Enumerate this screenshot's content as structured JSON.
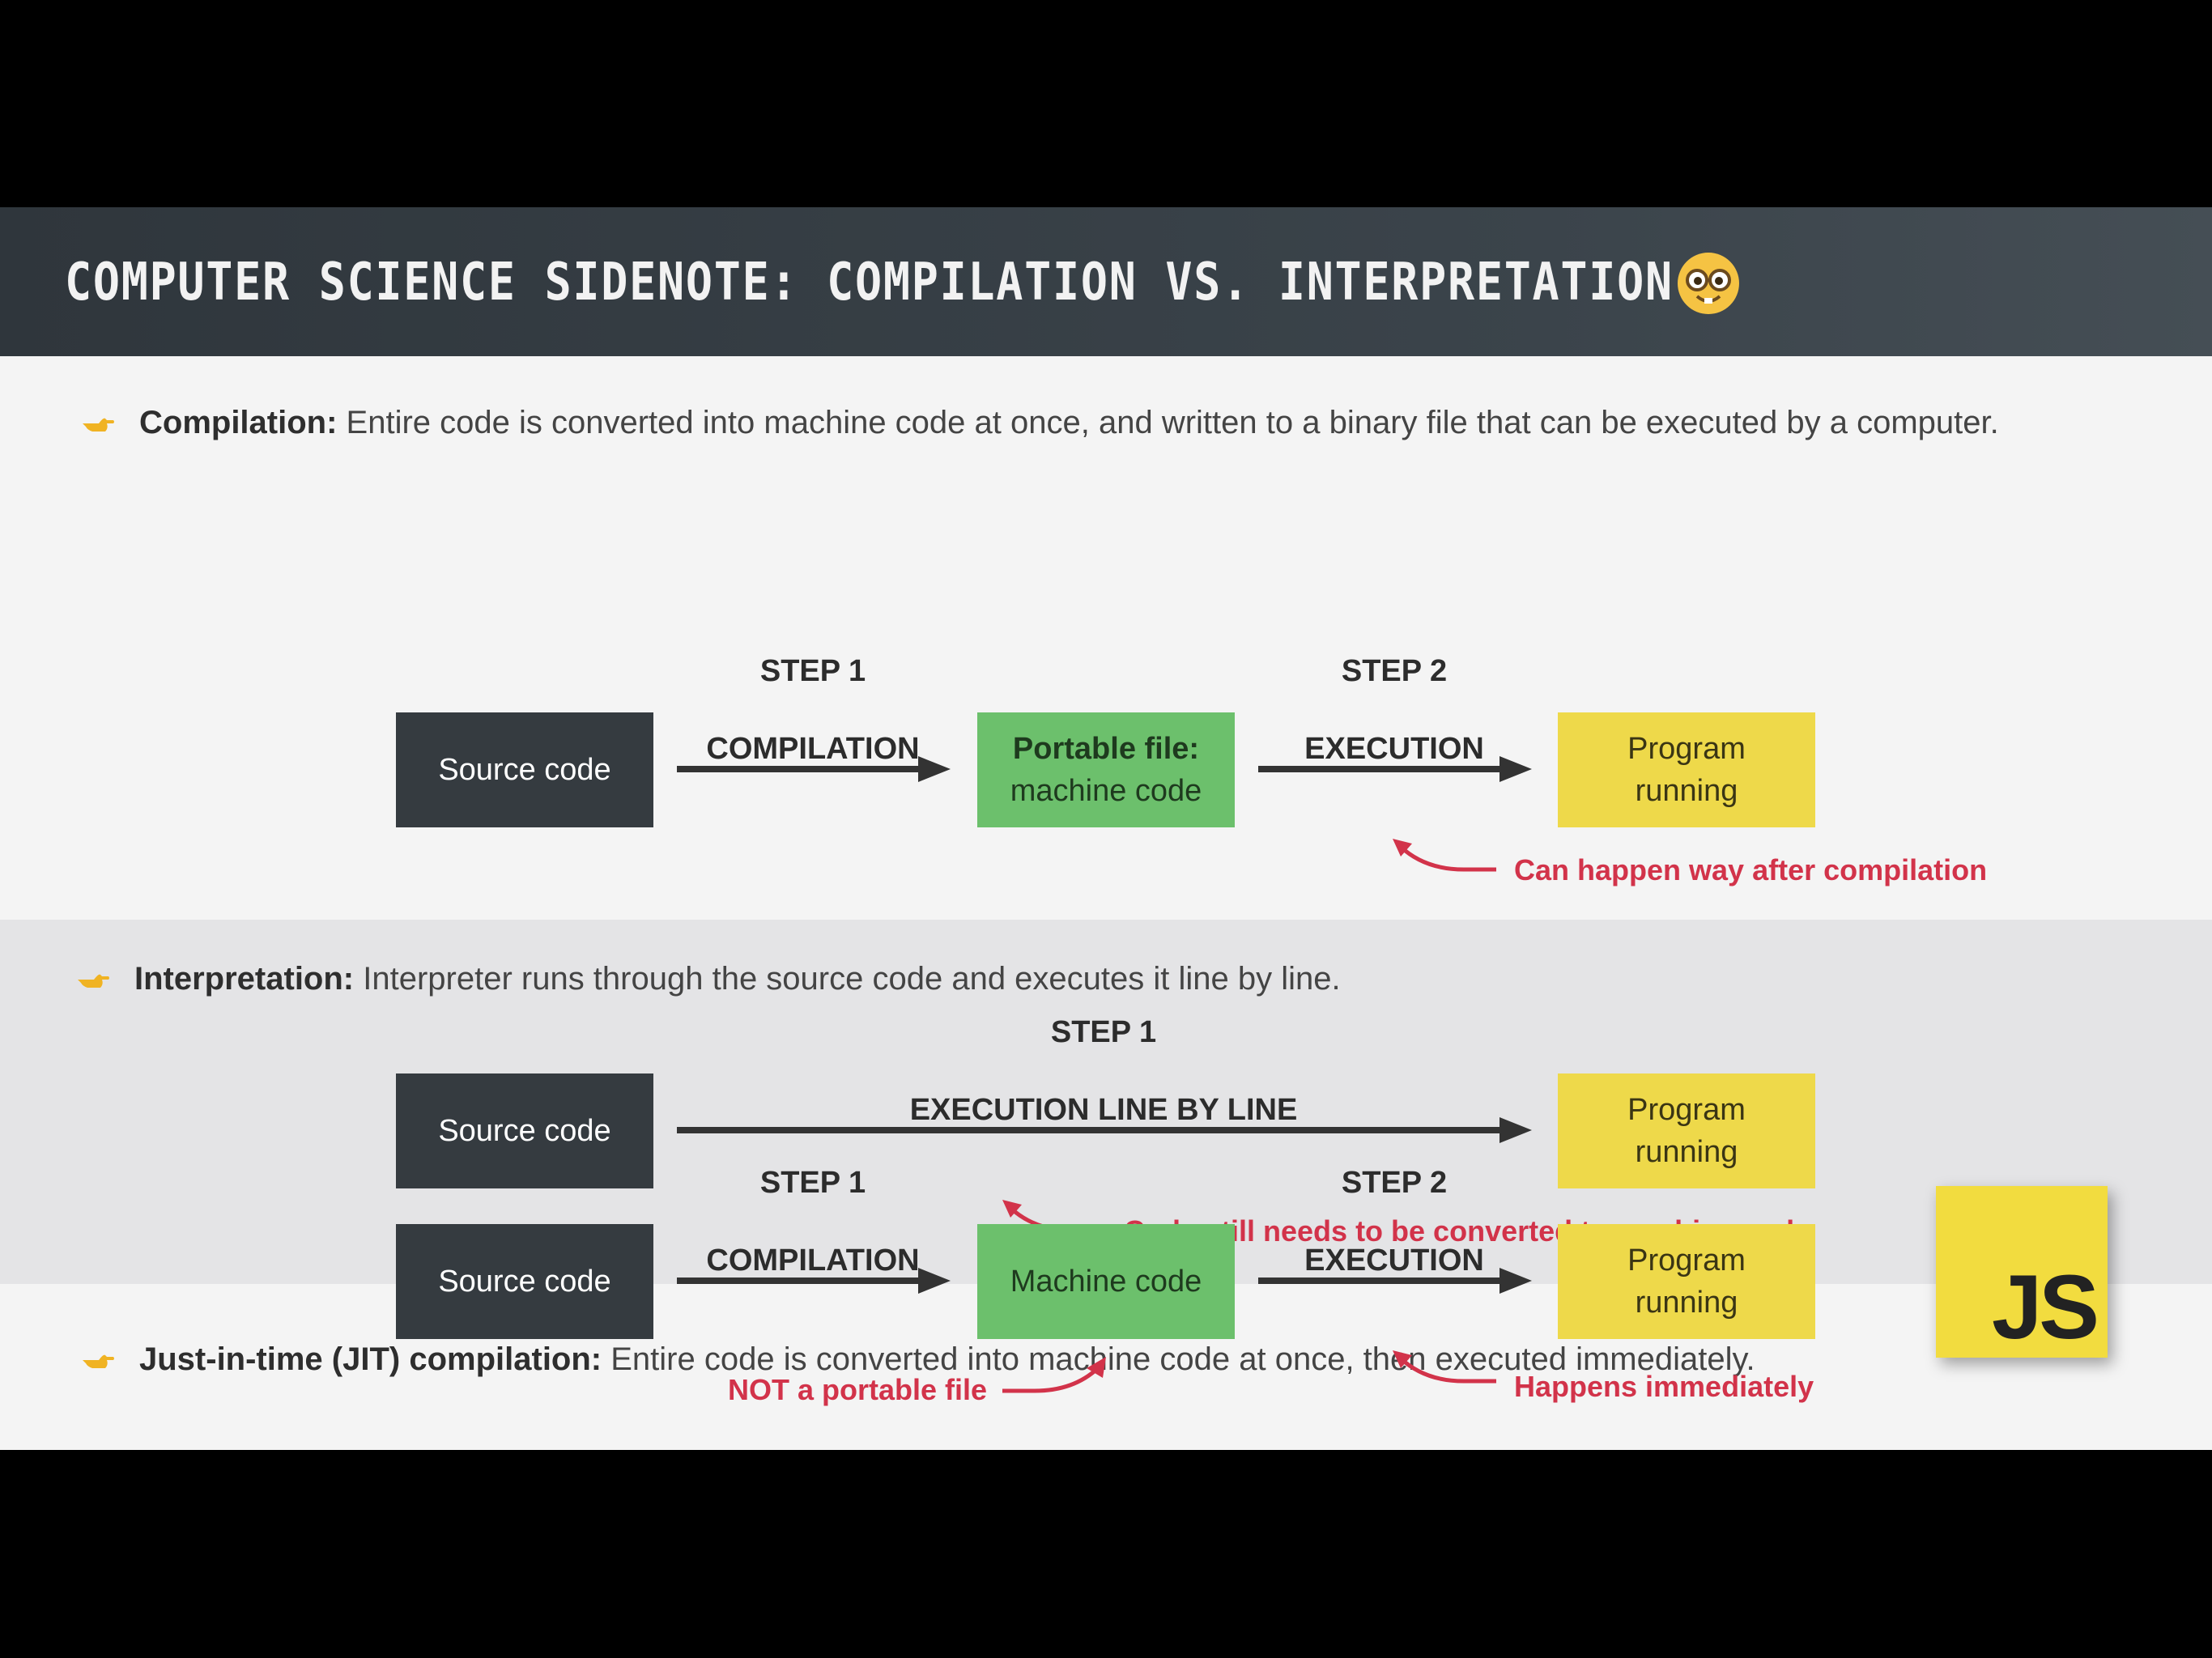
{
  "title": "COMPUTER SCIENCE SIDENOTE: COMPILATION VS. INTERPRETATION",
  "title_emoji": "nerd-face-emoji",
  "sections": {
    "compilation": {
      "bullet_icon": "pointing-hand-icon",
      "term": "Compilation:",
      "description": " Entire code is converted into machine code at once, and written to a binary file that can be executed by a computer.",
      "source_box": "Source code",
      "step1_top": "STEP 1",
      "step1_bottom": "COMPILATION",
      "middle_box_line1": "Portable file:",
      "middle_box_line2": "machine code",
      "step2_top": "STEP 2",
      "step2_bottom": "EXECUTION",
      "end_box_line1": "Program",
      "end_box_line2": "running",
      "note": "Can happen way after compilation"
    },
    "interpretation": {
      "bullet_icon": "pointing-hand-icon",
      "term": "Interpretation:",
      "description": " Interpreter runs through the source code and executes it line by line.",
      "source_box": "Source code",
      "step1_top": "STEP 1",
      "step1_bottom": "EXECUTION LINE BY LINE",
      "end_box_line1": "Program",
      "end_box_line2": "running",
      "note": "Code still needs to be converted to machine code"
    },
    "jit": {
      "bullet_icon": "pointing-hand-icon",
      "term": "Just-in-time (JIT) compilation:",
      "description": " Entire code is converted into machine code at once, then executed immediately.",
      "source_box": "Source code",
      "step1_top": "STEP 1",
      "step1_bottom": "COMPILATION",
      "middle_box": "Machine code",
      "step2_top": "STEP 2",
      "step2_bottom": "EXECUTION",
      "end_box_line1": "Program",
      "end_box_line2": "running",
      "note_left": "NOT a portable file",
      "note_right": "Happens immediately"
    }
  },
  "js_logo": "JS",
  "colors": {
    "title_bar": "#353d43",
    "dark_box": "#353b40",
    "green_box": "#6cc06c",
    "yellow_box": "#eed94a",
    "note_red": "#d2334a",
    "band_gray": "#e4e4e6"
  }
}
